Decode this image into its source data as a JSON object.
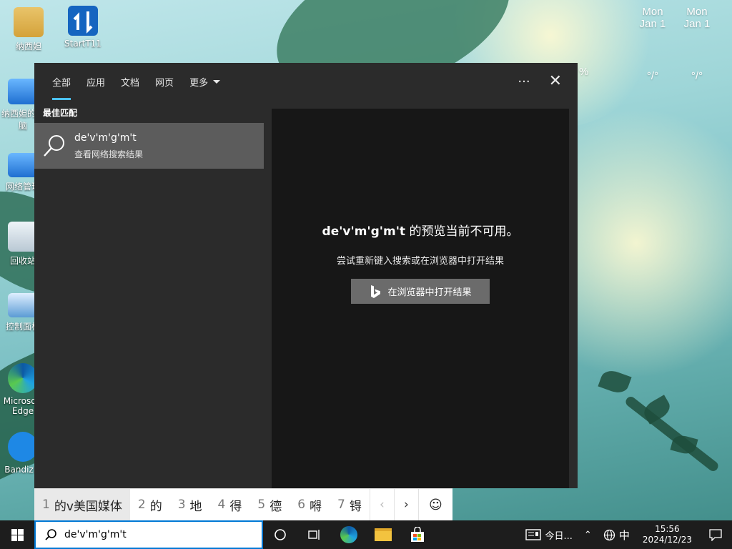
{
  "desktop": {
    "icons": [
      {
        "label": "纳西妲",
        "icon": "user-folder-icon"
      },
      {
        "label": "StartT11",
        "icon": "start-app-icon"
      },
      {
        "label": "纳西妲的电脑",
        "icon": "computer-icon"
      },
      {
        "label": "网络管理",
        "icon": "network-icon"
      },
      {
        "label": "回收站",
        "icon": "recycle-bin-icon"
      },
      {
        "label": "控制面板",
        "icon": "control-panel-icon"
      },
      {
        "label": "Microsoft Edge",
        "icon": "edge-icon"
      },
      {
        "label": "Bandizip",
        "icon": "bandizip-icon"
      }
    ],
    "weather": [
      {
        "day": "Mon",
        "date": "Jan 1",
        "temp": "°/°"
      },
      {
        "day": "Mon",
        "date": "Jan 1",
        "temp": "°/°"
      }
    ],
    "weather_pct": "%"
  },
  "search_panel": {
    "tabs": [
      {
        "label": "全部",
        "active": true
      },
      {
        "label": "应用"
      },
      {
        "label": "文档"
      },
      {
        "label": "网页"
      },
      {
        "label": "更多",
        "dropdown": true
      }
    ],
    "more_options_label": "···",
    "best_match_label": "最佳匹配",
    "result": {
      "title": "de'v'm'g'm't",
      "subtitle": "查看网络搜索结果"
    },
    "preview": {
      "query": "de'v'm'g'm't",
      "unavailable_text": " 的预览当前不可用。",
      "hint": "尝试重新键入搜索或在浏览器中打开结果",
      "open_button": "在浏览器中打开结果"
    }
  },
  "ime": {
    "candidates": [
      {
        "n": "1",
        "text": "的v美国媒体"
      },
      {
        "n": "2",
        "text": "的"
      },
      {
        "n": "3",
        "text": "地"
      },
      {
        "n": "4",
        "text": "得"
      },
      {
        "n": "5",
        "text": "德"
      },
      {
        "n": "6",
        "text": "嘚"
      },
      {
        "n": "7",
        "text": "锝"
      }
    ],
    "prev": "‹",
    "next": "›",
    "emoji": "☺"
  },
  "taskbar": {
    "search_value": "de'v'm'g'm't",
    "widgets_label": "今日...",
    "ime_mode": "中",
    "time": "15:56",
    "date": "2024/12/23"
  }
}
